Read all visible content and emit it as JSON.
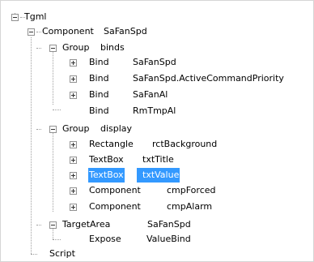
{
  "tree": {
    "root": "Tgml",
    "component": {
      "type": "Component",
      "name": "SaFanSpd"
    },
    "group_binds": {
      "type": "Group",
      "name": "binds"
    },
    "binds": [
      {
        "type": "Bind",
        "name": "SaFanSpd"
      },
      {
        "type": "Bind",
        "name": "SaFanSpd.ActiveCommandPriority"
      },
      {
        "type": "Bind",
        "name": "SaFanAl"
      },
      {
        "type": "Bind",
        "name": "RmTmpAl"
      }
    ],
    "group_display": {
      "type": "Group",
      "name": "display"
    },
    "display_items": [
      {
        "type": "Rectangle",
        "name": "rctBackground"
      },
      {
        "type": "TextBox",
        "name": "txtTitle"
      },
      {
        "type": "TextBox",
        "name": "txtValue",
        "selected": true
      },
      {
        "type": "Component",
        "name": "cmpForced"
      },
      {
        "type": "Component",
        "name": "cmpAlarm"
      }
    ],
    "target_area": {
      "type": "TargetArea",
      "name": "SaFanSpd"
    },
    "expose": {
      "type": "Expose",
      "name": "ValueBind"
    },
    "script": "Script"
  },
  "colors": {
    "selection": "#3399ff",
    "tree_line": "#a0a0a0",
    "toggle_border": "#919191"
  }
}
